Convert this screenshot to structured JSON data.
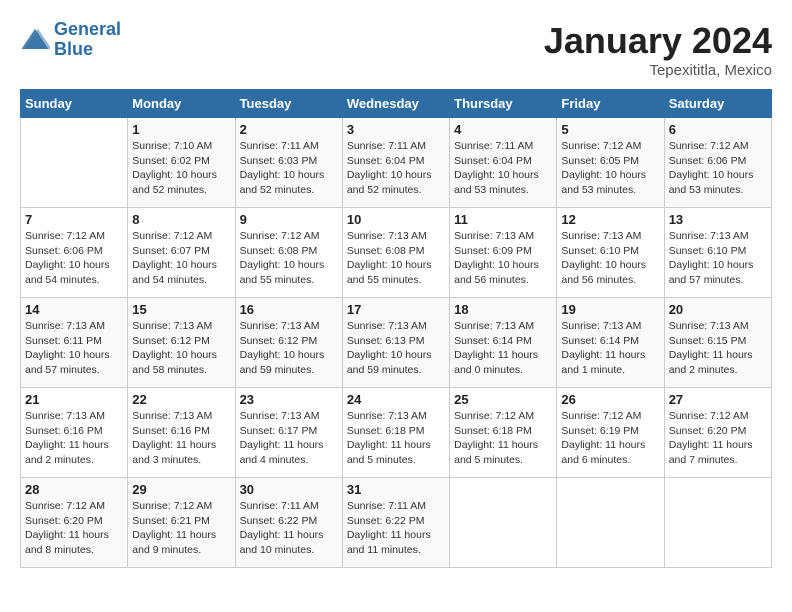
{
  "header": {
    "logo_line1": "General",
    "logo_line2": "Blue",
    "month": "January 2024",
    "location": "Tepexititla, Mexico"
  },
  "days_of_week": [
    "Sunday",
    "Monday",
    "Tuesday",
    "Wednesday",
    "Thursday",
    "Friday",
    "Saturday"
  ],
  "weeks": [
    [
      {
        "day": "",
        "info": ""
      },
      {
        "day": "1",
        "info": "Sunrise: 7:10 AM\nSunset: 6:02 PM\nDaylight: 10 hours\nand 52 minutes."
      },
      {
        "day": "2",
        "info": "Sunrise: 7:11 AM\nSunset: 6:03 PM\nDaylight: 10 hours\nand 52 minutes."
      },
      {
        "day": "3",
        "info": "Sunrise: 7:11 AM\nSunset: 6:04 PM\nDaylight: 10 hours\nand 52 minutes."
      },
      {
        "day": "4",
        "info": "Sunrise: 7:11 AM\nSunset: 6:04 PM\nDaylight: 10 hours\nand 53 minutes."
      },
      {
        "day": "5",
        "info": "Sunrise: 7:12 AM\nSunset: 6:05 PM\nDaylight: 10 hours\nand 53 minutes."
      },
      {
        "day": "6",
        "info": "Sunrise: 7:12 AM\nSunset: 6:06 PM\nDaylight: 10 hours\nand 53 minutes."
      }
    ],
    [
      {
        "day": "7",
        "info": "Sunrise: 7:12 AM\nSunset: 6:06 PM\nDaylight: 10 hours\nand 54 minutes."
      },
      {
        "day": "8",
        "info": "Sunrise: 7:12 AM\nSunset: 6:07 PM\nDaylight: 10 hours\nand 54 minutes."
      },
      {
        "day": "9",
        "info": "Sunrise: 7:12 AM\nSunset: 6:08 PM\nDaylight: 10 hours\nand 55 minutes."
      },
      {
        "day": "10",
        "info": "Sunrise: 7:13 AM\nSunset: 6:08 PM\nDaylight: 10 hours\nand 55 minutes."
      },
      {
        "day": "11",
        "info": "Sunrise: 7:13 AM\nSunset: 6:09 PM\nDaylight: 10 hours\nand 56 minutes."
      },
      {
        "day": "12",
        "info": "Sunrise: 7:13 AM\nSunset: 6:10 PM\nDaylight: 10 hours\nand 56 minutes."
      },
      {
        "day": "13",
        "info": "Sunrise: 7:13 AM\nSunset: 6:10 PM\nDaylight: 10 hours\nand 57 minutes."
      }
    ],
    [
      {
        "day": "14",
        "info": "Sunrise: 7:13 AM\nSunset: 6:11 PM\nDaylight: 10 hours\nand 57 minutes."
      },
      {
        "day": "15",
        "info": "Sunrise: 7:13 AM\nSunset: 6:12 PM\nDaylight: 10 hours\nand 58 minutes."
      },
      {
        "day": "16",
        "info": "Sunrise: 7:13 AM\nSunset: 6:12 PM\nDaylight: 10 hours\nand 59 minutes."
      },
      {
        "day": "17",
        "info": "Sunrise: 7:13 AM\nSunset: 6:13 PM\nDaylight: 10 hours\nand 59 minutes."
      },
      {
        "day": "18",
        "info": "Sunrise: 7:13 AM\nSunset: 6:14 PM\nDaylight: 11 hours\nand 0 minutes."
      },
      {
        "day": "19",
        "info": "Sunrise: 7:13 AM\nSunset: 6:14 PM\nDaylight: 11 hours\nand 1 minute."
      },
      {
        "day": "20",
        "info": "Sunrise: 7:13 AM\nSunset: 6:15 PM\nDaylight: 11 hours\nand 2 minutes."
      }
    ],
    [
      {
        "day": "21",
        "info": "Sunrise: 7:13 AM\nSunset: 6:16 PM\nDaylight: 11 hours\nand 2 minutes."
      },
      {
        "day": "22",
        "info": "Sunrise: 7:13 AM\nSunset: 6:16 PM\nDaylight: 11 hours\nand 3 minutes."
      },
      {
        "day": "23",
        "info": "Sunrise: 7:13 AM\nSunset: 6:17 PM\nDaylight: 11 hours\nand 4 minutes."
      },
      {
        "day": "24",
        "info": "Sunrise: 7:13 AM\nSunset: 6:18 PM\nDaylight: 11 hours\nand 5 minutes."
      },
      {
        "day": "25",
        "info": "Sunrise: 7:12 AM\nSunset: 6:18 PM\nDaylight: 11 hours\nand 5 minutes."
      },
      {
        "day": "26",
        "info": "Sunrise: 7:12 AM\nSunset: 6:19 PM\nDaylight: 11 hours\nand 6 minutes."
      },
      {
        "day": "27",
        "info": "Sunrise: 7:12 AM\nSunset: 6:20 PM\nDaylight: 11 hours\nand 7 minutes."
      }
    ],
    [
      {
        "day": "28",
        "info": "Sunrise: 7:12 AM\nSunset: 6:20 PM\nDaylight: 11 hours\nand 8 minutes."
      },
      {
        "day": "29",
        "info": "Sunrise: 7:12 AM\nSunset: 6:21 PM\nDaylight: 11 hours\nand 9 minutes."
      },
      {
        "day": "30",
        "info": "Sunrise: 7:11 AM\nSunset: 6:22 PM\nDaylight: 11 hours\nand 10 minutes."
      },
      {
        "day": "31",
        "info": "Sunrise: 7:11 AM\nSunset: 6:22 PM\nDaylight: 11 hours\nand 11 minutes."
      },
      {
        "day": "",
        "info": ""
      },
      {
        "day": "",
        "info": ""
      },
      {
        "day": "",
        "info": ""
      }
    ]
  ]
}
